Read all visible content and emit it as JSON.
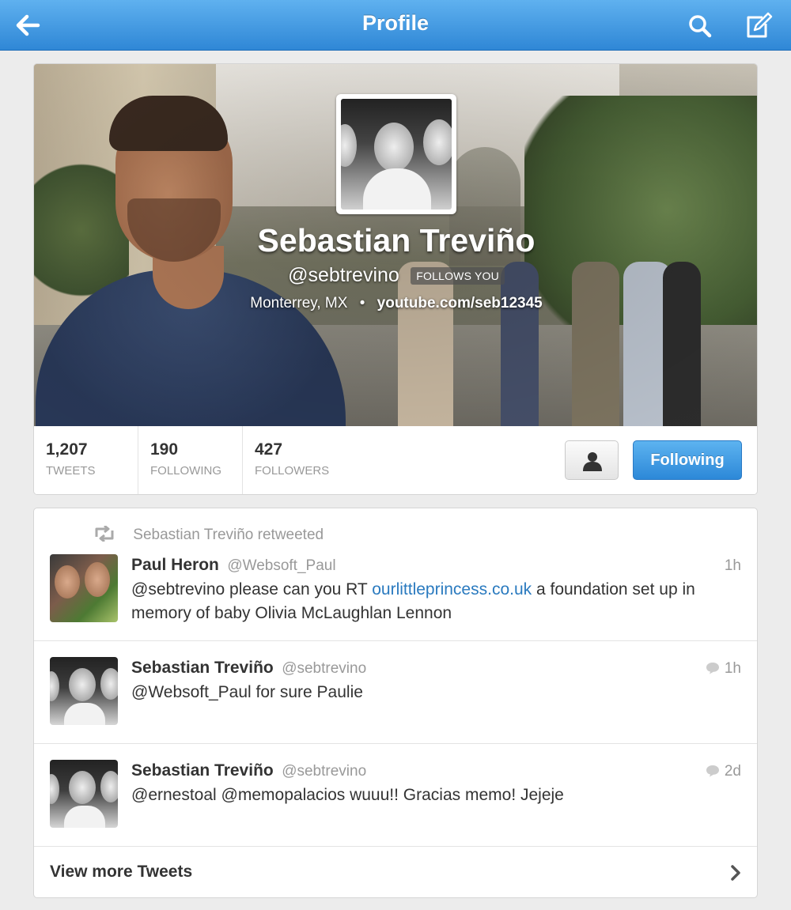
{
  "nav": {
    "title": "Profile"
  },
  "profile": {
    "name": "Sebastian Treviño",
    "handle": "@sebtrevino",
    "follows_badge": "FOLLOWS YOU",
    "location": "Monterrey, MX",
    "separator": "•",
    "url": "youtube.com/seb12345",
    "stats": [
      {
        "value": "1,207",
        "label": "TWEETS"
      },
      {
        "value": "190",
        "label": "FOLLOWING"
      },
      {
        "value": "427",
        "label": "FOLLOWERS"
      }
    ],
    "following_button": "Following"
  },
  "tweets": [
    {
      "retweet_label": "Sebastian Treviño retweeted",
      "name": "Paul Heron",
      "handle": "@Websoft_Paul",
      "time": "1h",
      "text_before": "@sebtrevino please can you RT ",
      "link": "ourlittleprincess.co.uk",
      "text_after": " a foundation set up in memory of baby Olivia McLaughlan Lennon"
    },
    {
      "name": "Sebastian Treviño",
      "handle": "@sebtrevino",
      "time": "1h",
      "text": "@Websoft_Paul for sure Paulie"
    },
    {
      "name": "Sebastian Treviño",
      "handle": "@sebtrevino",
      "time": "2d",
      "text": "@ernestoal @memopalacios wuuu!! Gracias memo! Jejeje"
    }
  ],
  "view_more": "View more Tweets",
  "icons": {
    "back": "back-arrow-icon",
    "search": "search-icon",
    "compose": "compose-icon",
    "person": "person-icon",
    "retweet": "retweet-icon",
    "reply": "reply-bubble-icon",
    "chevron": "chevron-right-icon"
  },
  "colors": {
    "nav_blue": "#3a92dd",
    "following_blue": "#2c88d8",
    "link_blue": "#2a7abf"
  }
}
